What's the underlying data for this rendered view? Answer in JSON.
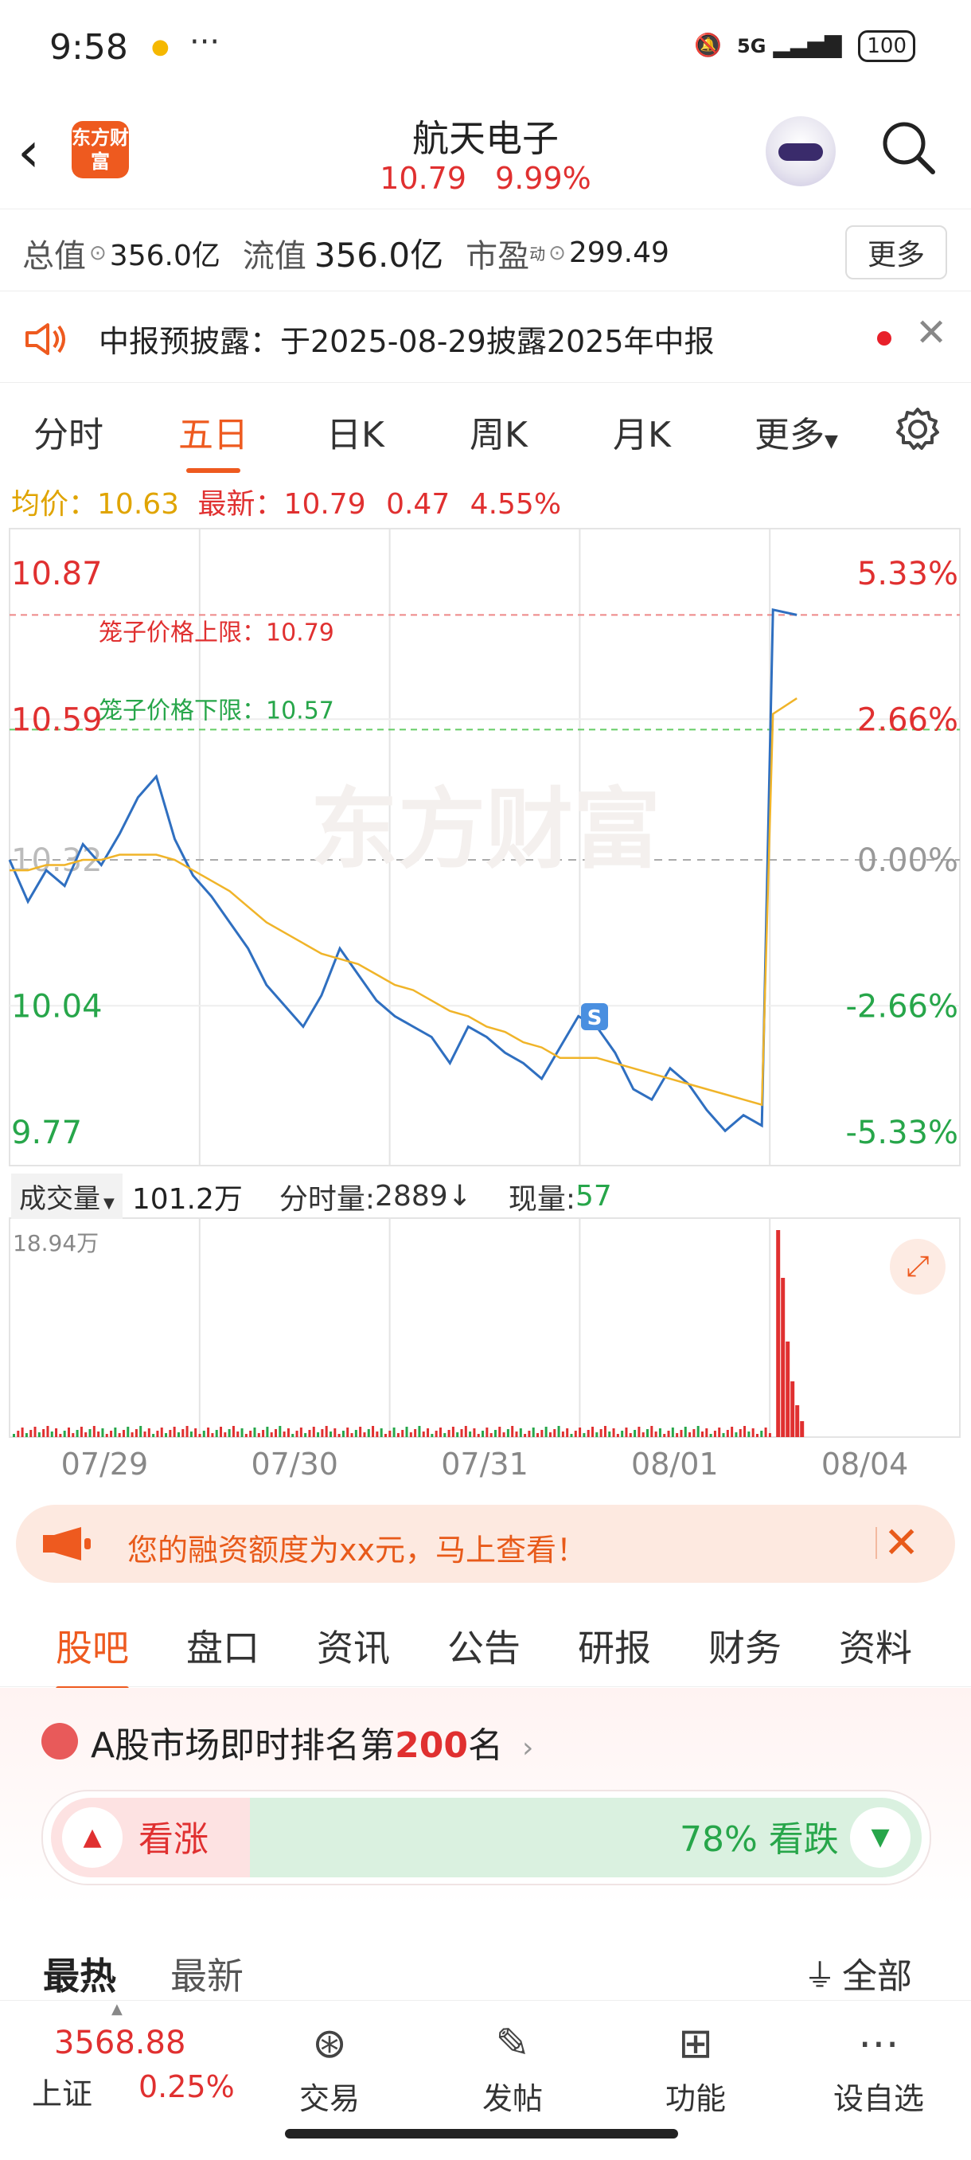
{
  "status_bar": {
    "time": "9:58",
    "dots": "···",
    "network": "5G",
    "battery": "100"
  },
  "header": {
    "logo_text": "东方财富",
    "title": "航天电子",
    "price": "10.79",
    "change_pct": "9.99%"
  },
  "info": {
    "total_value_label": "总值",
    "total_value": "356.0亿",
    "float_value_label": "流值",
    "float_value": "356.0亿",
    "pe_label": "市盈",
    "pe_sup": "动",
    "pe_value": "299.49",
    "more": "更多"
  },
  "notice": {
    "text": "中报预披露：于2025-08-29披露2025年中报"
  },
  "ktabs": [
    "分时",
    "五日",
    "日K",
    "周K",
    "月K",
    "更多"
  ],
  "ktab_active": 1,
  "avg_line": {
    "avg_label": "均价：",
    "avg_value": "10.63",
    "latest_label": "最新：",
    "latest_value": "10.79",
    "change": "0.47",
    "change_pct": "4.55%"
  },
  "chart_data": {
    "type": "line",
    "y_price_labels": [
      "10.87",
      "10.59",
      "10.32",
      "10.04",
      "9.77"
    ],
    "y_pct_labels": [
      "5.33%",
      "2.66%",
      "0.00%",
      "-2.66%",
      "-5.33%"
    ],
    "ylim": [
      9.77,
      10.87
    ],
    "upper_limit_label": "笼子价格上限：10.79",
    "lower_limit_label": "笼子价格下限：10.57",
    "upper_limit": 10.79,
    "lower_limit": 10.57,
    "watermark": "东方财富",
    "x_dates": [
      "07/29",
      "07/30",
      "07/31",
      "08/01",
      "08/04"
    ],
    "series": [
      {
        "name": "price",
        "color": "#2f6fc0",
        "values": [
          10.32,
          10.24,
          10.3,
          10.27,
          10.35,
          10.31,
          10.37,
          10.44,
          10.48,
          10.36,
          10.29,
          10.25,
          10.2,
          10.15,
          10.08,
          10.04,
          10.0,
          10.06,
          10.15,
          10.1,
          10.05,
          10.02,
          10.0,
          9.98,
          9.93,
          10.0,
          9.98,
          9.95,
          9.93,
          9.9,
          9.96,
          10.02,
          10.0,
          9.95,
          9.88,
          9.86,
          9.92,
          9.89,
          9.84,
          9.8,
          9.83,
          9.81,
          10.8,
          10.79
        ]
      },
      {
        "name": "avg",
        "color": "#f0b429",
        "values": [
          10.3,
          10.3,
          10.31,
          10.31,
          10.32,
          10.32,
          10.33,
          10.33,
          10.33,
          10.32,
          10.3,
          10.28,
          10.26,
          10.23,
          10.2,
          10.18,
          10.16,
          10.14,
          10.13,
          10.12,
          10.1,
          10.08,
          10.07,
          10.05,
          10.03,
          10.02,
          10.0,
          9.99,
          9.97,
          9.96,
          9.94,
          9.94,
          9.94,
          9.93,
          9.92,
          9.91,
          9.9,
          9.89,
          9.88,
          9.87,
          9.86,
          9.85,
          10.6,
          10.63
        ]
      }
    ]
  },
  "volume": {
    "label": "成交量",
    "total": "101.2万",
    "per_label": "分时量:",
    "per_value": "2889",
    "per_arrow": "↓",
    "now_label": "现量:",
    "now_value": "57",
    "max_label": "18.94万"
  },
  "loan_banner": {
    "text": "您的融资额度为xx元，马上查看！"
  },
  "bottom_tabs": [
    "股吧",
    "盘口",
    "资讯",
    "公告",
    "研报",
    "财务",
    "资料"
  ],
  "bottom_tab_active": 0,
  "rank": {
    "prefix": "A股市场即时排名第",
    "number": "200",
    "suffix": "名"
  },
  "vote": {
    "up_label": "看涨",
    "down_label": "78% 看跌"
  },
  "feed_tabs": {
    "hot": "最热",
    "new": "最新",
    "all": "全部"
  },
  "nav": {
    "index_value": "3568.88",
    "index_name": "上证",
    "index_pct": "0.25%",
    "items": [
      "交易",
      "发帖",
      "功能",
      "设自选"
    ]
  }
}
